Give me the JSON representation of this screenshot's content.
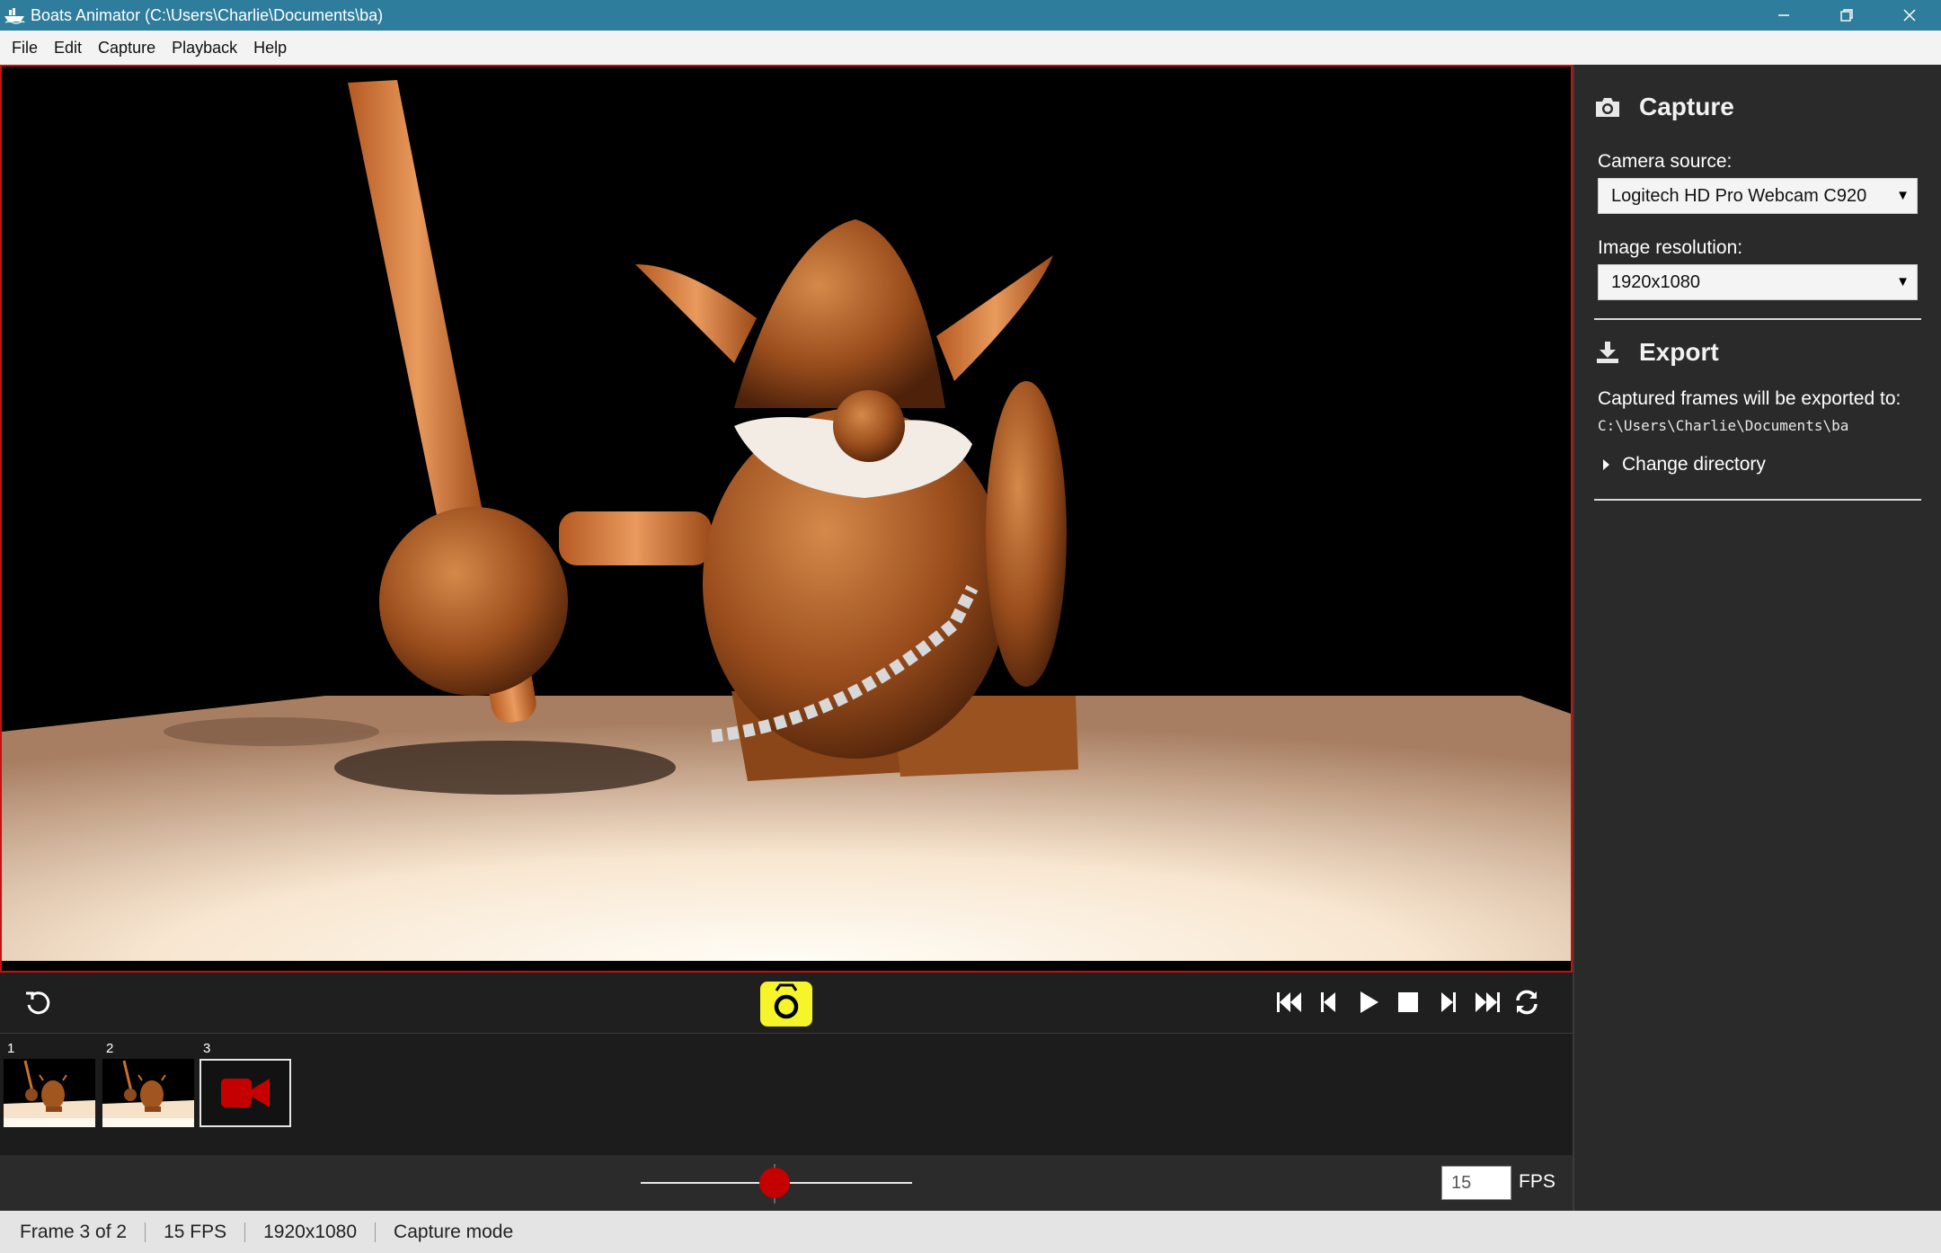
{
  "window": {
    "title": "Boats Animator (C:\\Users\\Charlie\\Documents\\ba)",
    "minimize_icon": "minimize-icon",
    "restore_icon": "restore-icon",
    "close_icon": "close-icon"
  },
  "menu": [
    "File",
    "Edit",
    "Capture",
    "Playback",
    "Help"
  ],
  "sidebar": {
    "capture": {
      "heading": "Capture",
      "icon": "camera-icon",
      "camera_source_label": "Camera source:",
      "camera_source_value": "Logitech HD Pro Webcam C920",
      "resolution_label": "Image resolution:",
      "resolution_value": "1920x1080"
    },
    "export": {
      "heading": "Export",
      "icon": "download-icon",
      "description": "Captured frames will be exported to:",
      "path": "C:\\Users\\Charlie\\Documents\\ba",
      "change_directory": "Change directory"
    }
  },
  "controls": {
    "undo_icon": "undo-icon",
    "capture_icon": "camera-icon",
    "capture_color": "#f6f52a",
    "playback_icons": [
      "skip-first-icon",
      "step-back-icon",
      "play-icon",
      "stop-icon",
      "step-forward-icon",
      "skip-last-icon",
      "loop-icon"
    ]
  },
  "frames": [
    {
      "number": "1",
      "type": "thumbnail"
    },
    {
      "number": "2",
      "type": "thumbnail"
    },
    {
      "number": "3",
      "type": "live",
      "icon": "video-camera-icon",
      "icon_color": "#c40000"
    }
  ],
  "timeline": {
    "slider_position": 0.5,
    "fps_value": "15",
    "fps_label": "FPS"
  },
  "status": {
    "frame": "Frame 3 of 2",
    "fps": "15 FPS",
    "resolution": "1920x1080",
    "mode": "Capture mode"
  },
  "colors": {
    "titlebar": "#2f7d9c",
    "preview_border": "#c81010",
    "accent_red": "#c40000"
  }
}
